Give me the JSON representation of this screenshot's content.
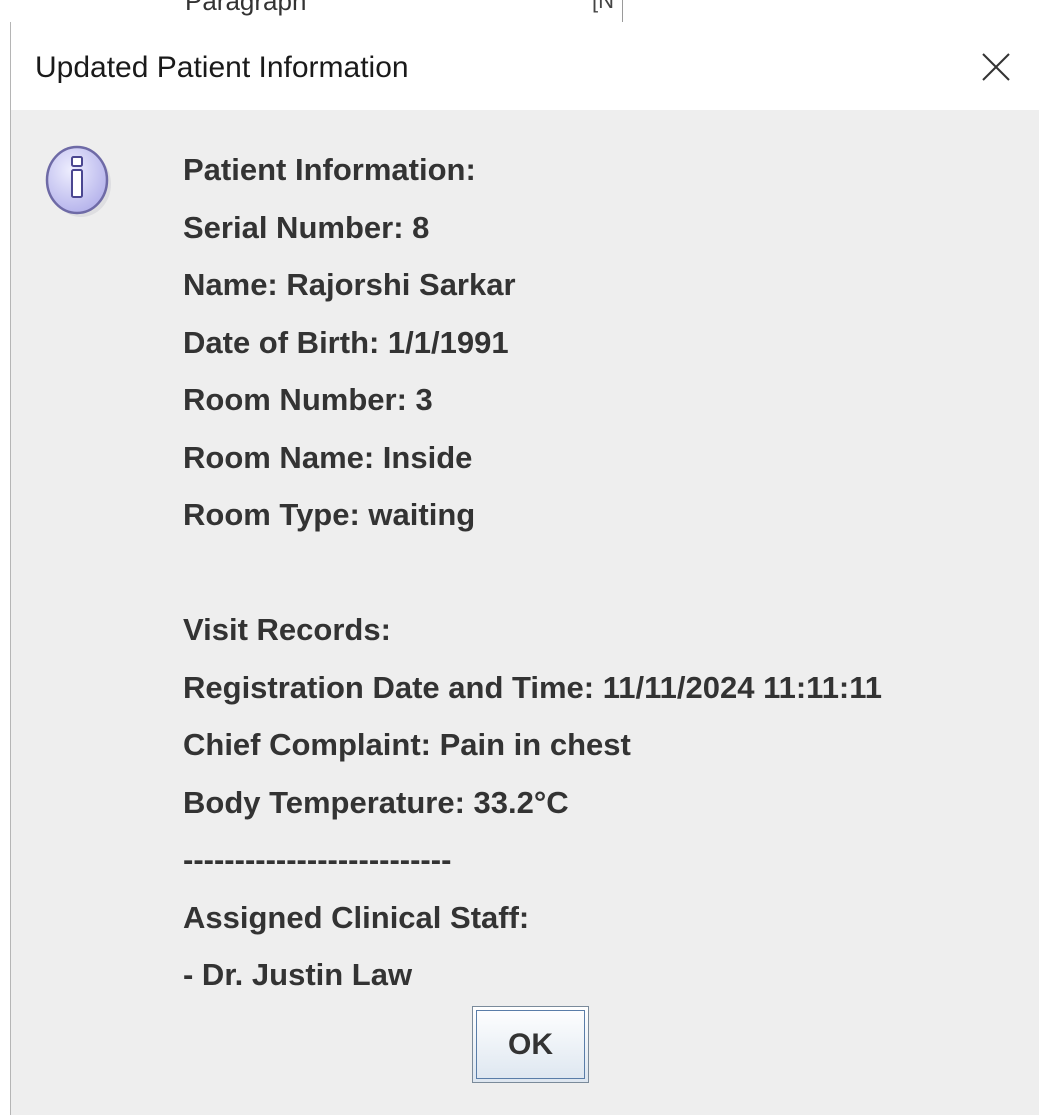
{
  "background": {
    "partial_text": "Paragraph"
  },
  "dialog": {
    "title": "Updated Patient Information",
    "close_icon": "close-icon",
    "info_icon": "info-icon",
    "ok_label": "OK",
    "colors": {
      "dialog_background": "#eeeeee",
      "titlebar_background": "#ffffff",
      "text": "#333333",
      "icon_fill": "#c9c8f2"
    },
    "lines": [
      "Patient Information:",
      "Serial Number: 8",
      "Name: Rajorshi Sarkar",
      "Date of Birth: 1/1/1991",
      "Room Number: 3",
      "Room Name: Inside",
      "Room Type: waiting",
      "",
      "Visit Records:",
      "Registration Date and Time: 11/11/2024 11:11:11",
      "Chief Complaint: Pain in chest",
      "Body Temperature: 33.2°C",
      "--------------------------",
      "Assigned Clinical Staff:",
      "- Dr. Justin Law"
    ]
  }
}
